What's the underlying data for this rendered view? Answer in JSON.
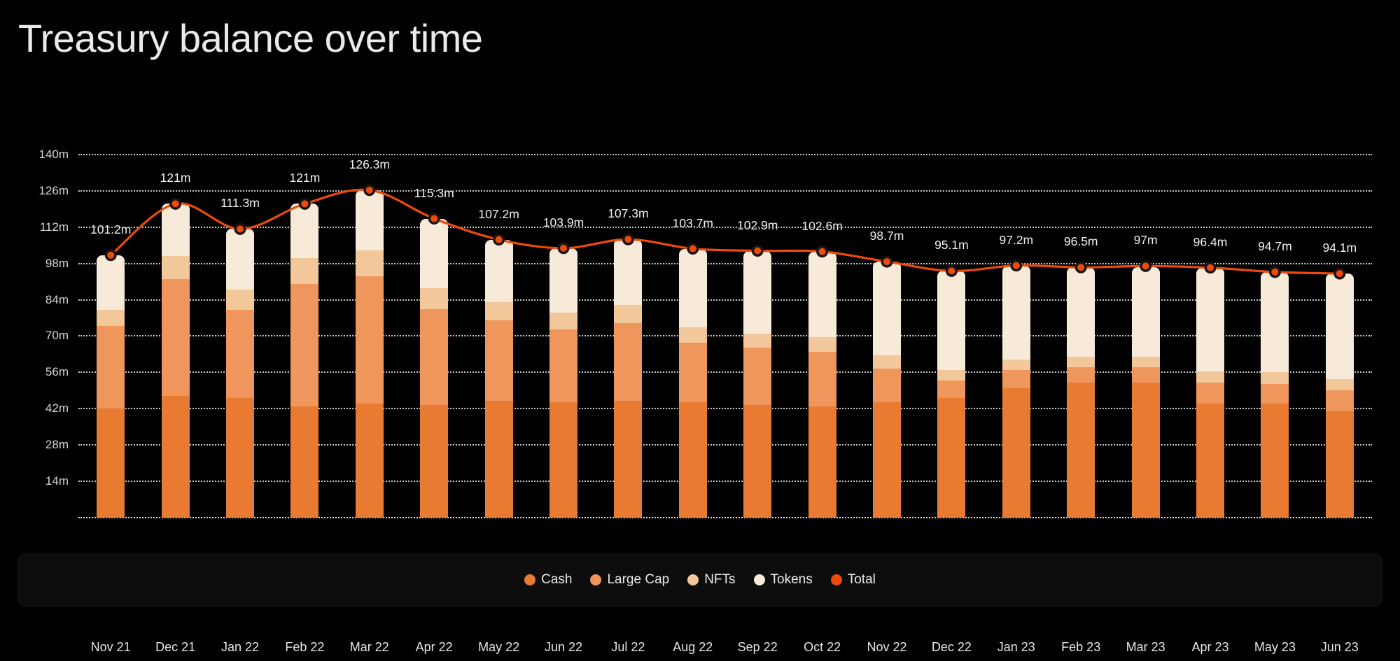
{
  "header": {
    "title": "Treasury balance over time"
  },
  "legend": {
    "items": [
      {
        "label": "Cash",
        "color": "#e87a32",
        "icon": "legend-dot-icon"
      },
      {
        "label": "Large Cap",
        "color": "#ef965c",
        "icon": "legend-dot-icon"
      },
      {
        "label": "NFTs",
        "color": "#f2c79a",
        "icon": "legend-dot-icon"
      },
      {
        "label": "Tokens",
        "color": "#f7ead8",
        "icon": "legend-dot-icon"
      },
      {
        "label": "Total",
        "color": "#ef4a09",
        "icon": "legend-dot-icon"
      }
    ]
  },
  "chart_data": {
    "type": "bar",
    "subtype": "stacked-bar-with-line-overlay",
    "title": "Treasury balance over time",
    "xlabel": "",
    "ylabel": "",
    "ylim": [
      0,
      147
    ],
    "yticks": [
      14,
      28,
      42,
      56,
      70,
      84,
      98,
      112,
      126,
      140
    ],
    "ytick_labels": [
      "14m",
      "28m",
      "42m",
      "56m",
      "70m",
      "84m",
      "98m",
      "112m",
      "126m",
      "140m"
    ],
    "grid": true,
    "grid_style": "dotted-horizontal",
    "legend_position": "bottom",
    "value_suffix": "m",
    "categories": [
      "Nov 21",
      "Dec 21",
      "Jan 22",
      "Feb 22",
      "Mar 22",
      "Apr 22",
      "May 22",
      "Jun 22",
      "Jul 22",
      "Aug 22",
      "Sep 22",
      "Oct 22",
      "Nov 22",
      "Dec 22",
      "Jan 23",
      "Feb 23",
      "Mar 23",
      "Apr 23",
      "May 23",
      "Jun 23"
    ],
    "series": [
      {
        "name": "Cash",
        "color": "#e87a32",
        "values": [
          42.0,
          47.0,
          46.0,
          43.0,
          44.0,
          43.5,
          45.0,
          44.5,
          45.0,
          44.5,
          43.5,
          43.0,
          44.5,
          46.0,
          50.0,
          52.0,
          52.0,
          44.0,
          44.0,
          41.0
        ]
      },
      {
        "name": "Large Cap",
        "color": "#ef965c",
        "values": [
          32.0,
          45.0,
          34.0,
          47.0,
          49.0,
          37.0,
          31.0,
          28.0,
          30.0,
          23.0,
          22.0,
          21.0,
          13.0,
          7.0,
          7.0,
          6.0,
          6.0,
          8.0,
          7.5,
          8.0
        ]
      },
      {
        "name": "NFTs",
        "color": "#f2c79a",
        "values": [
          6.0,
          9.0,
          8.0,
          10.0,
          10.0,
          8.0,
          7.0,
          6.5,
          7.0,
          6.0,
          5.5,
          5.5,
          5.0,
          4.0,
          4.0,
          4.0,
          4.0,
          4.5,
          4.5,
          4.5
        ]
      },
      {
        "name": "Tokens",
        "color": "#f7ead8",
        "values": [
          21.2,
          20.0,
          23.3,
          21.0,
          23.3,
          26.8,
          24.2,
          24.9,
          25.3,
          30.2,
          31.9,
          33.1,
          36.2,
          38.1,
          36.2,
          34.5,
          34.5,
          39.9,
          38.7,
          40.6
        ]
      }
    ],
    "total_line": {
      "name": "Total",
      "color": "#ef4a09",
      "marker": "circle",
      "values": [
        101.2,
        121,
        111.3,
        121,
        126.3,
        115.3,
        107.2,
        103.9,
        107.3,
        103.7,
        102.9,
        102.6,
        98.7,
        95.1,
        97.2,
        96.5,
        97,
        96.4,
        94.7,
        94.1
      ],
      "labels": [
        "101.2m",
        "121m",
        "111.3m",
        "121m",
        "126.3m",
        "115.3m",
        "107.2m",
        "103.9m",
        "107.3m",
        "103.7m",
        "102.9m",
        "102.6m",
        "98.7m",
        "95.1m",
        "97.2m",
        "96.5m",
        "97m",
        "96.4m",
        "94.7m",
        "94.1m"
      ]
    }
  },
  "theme": {
    "background": "#000000",
    "legend_panel": "#0d0d0d",
    "text": "#e9e8e4",
    "grid": "#ffffff"
  }
}
